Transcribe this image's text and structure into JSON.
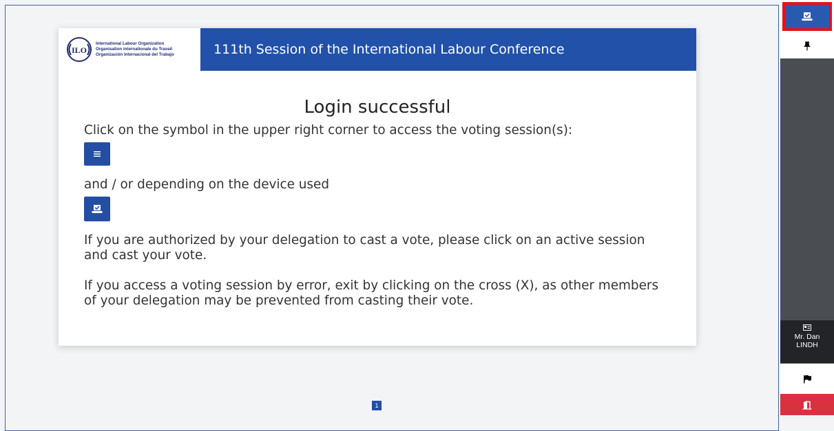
{
  "header": {
    "org_lines": [
      "International Labour Organization",
      "Organisation internationale du Travail",
      "Organización Internacional del Trabajo"
    ],
    "title": "111th Session of the International Labour Conference"
  },
  "main": {
    "login_title": "Login successful",
    "instruction": "Click on the symbol in the upper right corner to access the voting session(s):",
    "alt_device": "and / or depending on the device used",
    "authorized_text": "If you are authorized by your delegation to cast a vote, please click on an active session and cast your vote.",
    "error_text": "If you access a voting session by error, exit by clicking on the cross (X), as other members of your delegation may be prevented from casting their vote."
  },
  "sidebar": {
    "user_name_line1": "Mr. Dan",
    "user_name_line2": "LINDH"
  },
  "pagination": {
    "current": "1"
  },
  "colors": {
    "brand_blue": "#2151a8",
    "sidebar_dark": "#4a4d51",
    "exit_red": "#d9313f",
    "highlight": "#e8101c"
  }
}
